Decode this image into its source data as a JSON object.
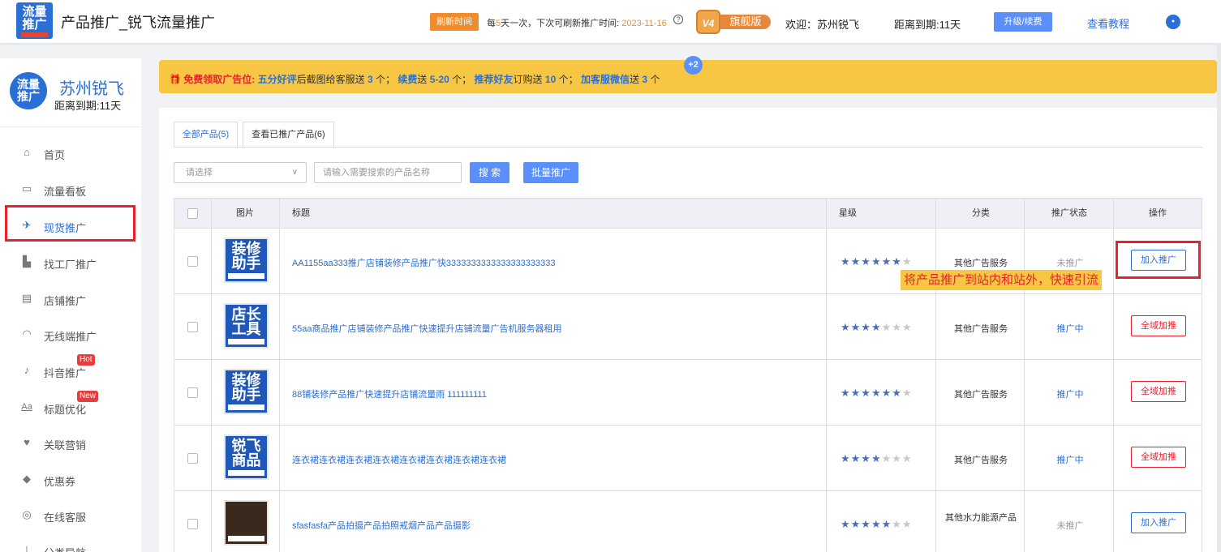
{
  "header": {
    "logo_line1": "流量",
    "logo_line2": "推广",
    "title": "产品推广_锐飞流量推广",
    "refresh_label": "刷新时间",
    "refresh_prefix": "每",
    "refresh_days": "5",
    "refresh_mid": "天一次，下次可刷新推广时间:",
    "refresh_date": "2023-11-16",
    "vip_level": "V4",
    "vip_name": "旗舰版",
    "welcome": "欢迎：苏州锐飞",
    "expire": "距离到期:11天",
    "upgrade_label": "升级/续费",
    "tutorial_label": "查看教程"
  },
  "sidebar": {
    "shop_logo_line1": "流量",
    "shop_logo_line2": "推广",
    "shop_name": "苏州锐飞",
    "shop_expire": "距离到期:11天",
    "items": [
      {
        "label": "首页",
        "icon": "home-icon"
      },
      {
        "label": "流量看板",
        "icon": "monitor-icon"
      },
      {
        "label": "现货推广",
        "icon": "plane-icon"
      },
      {
        "label": "找工厂推广",
        "icon": "factory-icon"
      },
      {
        "label": "店铺推广",
        "icon": "store-icon"
      },
      {
        "label": "无线端推广",
        "icon": "wifi-icon"
      },
      {
        "label": "抖音推广",
        "icon": "music-icon",
        "badge": "Hot"
      },
      {
        "label": "标题优化",
        "icon": "text-icon",
        "badge": "New"
      },
      {
        "label": "关联营销",
        "icon": "handshake-icon"
      },
      {
        "label": "优惠券",
        "icon": "coupon-tag-icon"
      },
      {
        "label": "在线客服",
        "icon": "headset-icon"
      },
      {
        "label": "分类导航",
        "icon": "sitemap-icon"
      }
    ]
  },
  "banner": {
    "lead": "免费领取广告位:",
    "p1": "五分好评",
    "t1": "后截图给客服送",
    "n1": "3",
    "t2": "个；",
    "p2": "续费",
    "t3": "送",
    "n2": "5-20",
    "t4": "个；",
    "p3": "推荐好友",
    "t5": "订购送",
    "n3": "10",
    "t6": "个；",
    "p4": "加客服微信",
    "t7": "送",
    "n4": "3",
    "t8": "个",
    "plus_badge": "+2"
  },
  "tabs": [
    {
      "label": "全部产品(5)",
      "active": true
    },
    {
      "label": "查看已推广产品(6)",
      "active": false
    }
  ],
  "filters": {
    "select_placeholder": "请选择",
    "search_placeholder": "请输入需要搜索的产品名称",
    "search_label": "搜 索",
    "batch_label": "批量推广"
  },
  "table": {
    "columns": [
      "图片",
      "标题",
      "星级",
      "分类",
      "推广状态",
      "操作"
    ],
    "rows": [
      {
        "thumb_l1": "装修",
        "thumb_l2": "助手",
        "title": "AA1155aa333推广店铺装修产品推广快3333333333333333333333",
        "stars": 6,
        "category": "其他广告服务",
        "status": "未推广",
        "action": "加入推广"
      },
      {
        "thumb_l1": "店长",
        "thumb_l2": "工具",
        "title": "55aa商品推广店铺装修产品推广快速提升店铺流量广告机服务器租用",
        "stars": 4,
        "category": "其他广告服务",
        "status": "推广中",
        "action": "全域加推"
      },
      {
        "thumb_l1": "装修",
        "thumb_l2": "助手",
        "title": "88铺装修产品推广快速提升店铺流量雨 111111111",
        "stars": 6,
        "category": "其他广告服务",
        "status": "推广中",
        "action": "全域加推"
      },
      {
        "thumb_l1": "锐飞",
        "thumb_l2": "商品",
        "title": "连衣裙连衣裙连衣裙连衣裙连衣裙连衣裙连衣裙连衣裙",
        "stars": 4,
        "category": "其他广告服务",
        "status": "推广中",
        "action": "全域加推"
      },
      {
        "thumb_l1": "",
        "thumb_l2": "",
        "title": "sfasfasfa产品拍摄产品拍照戒烟产品产品摄影",
        "stars": 5,
        "category": "其他水力能源产品",
        "status": "未推广",
        "action": "加入推广"
      }
    ],
    "star_total": 7
  },
  "tooltip": "将产品推广到站内和站外，快速引流",
  "colors": {
    "accent": "#2a6fd6",
    "banner": "#f7c744",
    "highlight": "#e5222e",
    "orange": "#f08c2b"
  }
}
